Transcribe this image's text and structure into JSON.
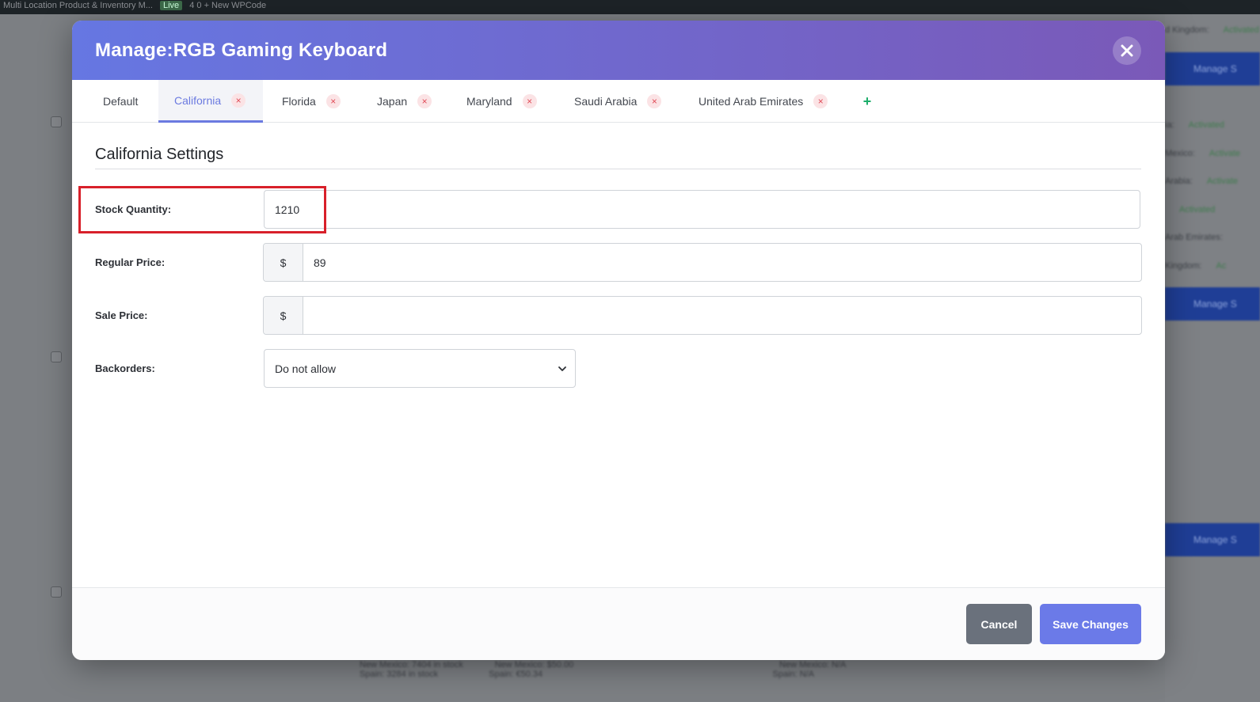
{
  "window": {
    "title": "Manage:RGB Gaming Keyboard"
  },
  "tabs": [
    {
      "label": "Default",
      "removable": false
    },
    {
      "label": "California",
      "removable": true,
      "active": true
    },
    {
      "label": "Florida",
      "removable": true
    },
    {
      "label": "Japan",
      "removable": true
    },
    {
      "label": "Maryland",
      "removable": true
    },
    {
      "label": "Saudi Arabia",
      "removable": true
    },
    {
      "label": "United Arab Emirates",
      "removable": true
    }
  ],
  "tab_remove_glyph": "×",
  "tab_add_glyph": "+",
  "section": {
    "title": "California Settings"
  },
  "fields": {
    "stock_quantity": {
      "label": "Stock Quantity:",
      "value": "1210"
    },
    "regular_price": {
      "label": "Regular Price:",
      "prefix": "$",
      "value": "89"
    },
    "sale_price": {
      "label": "Sale Price:",
      "prefix": "$",
      "value": ""
    },
    "backorders": {
      "label": "Backorders:",
      "selected": "Do not allow"
    }
  },
  "footer": {
    "cancel_label": "Cancel",
    "save_label": "Save Changes"
  },
  "background": {
    "admin_bar_text": "Multi Location Product & Inventory M...",
    "admin_bar_badge": "Live",
    "admin_bar_extra": "4   0   + New   WPCode",
    "right_column": [
      {
        "type": "blue",
        "label": "Manage S"
      },
      {
        "type": "row",
        "label": "d Kingdom:",
        "status": "Activated"
      },
      {
        "type": "row",
        "label": "ia:",
        "status": "Activated"
      },
      {
        "type": "row",
        "label": "Mexico:",
        "status": "Activate"
      },
      {
        "type": "row",
        "label": "Arabia:",
        "status": "Activate"
      },
      {
        "type": "row",
        "label": "",
        "status": "Activated"
      },
      {
        "type": "row",
        "label": "Arab Emirates:",
        "status": ""
      },
      {
        "type": "row",
        "label": "Kingdom:",
        "status": "Ac"
      }
    ],
    "under_text": [
      "New Mexico: 7404 in stock",
      "New Mexico: $50.00",
      "New Mexico: N/A",
      "Spain: 3284 in stock",
      "Spain: €50.34",
      "Spain: N/A"
    ]
  },
  "colors": {
    "header_gradient_start": "#6677e2",
    "header_gradient_end": "#7a59b8",
    "accent": "#6b7ae0",
    "remove_tab": "#e04a56",
    "add_tab": "#1dae6b",
    "highlight_box": "#d8202a",
    "cancel_button": "#6a717c",
    "save_button": "#6b7ae8"
  },
  "icons": {
    "close": "close-icon",
    "tab_remove": "close-icon",
    "tab_add": "plus-icon",
    "select": "chevron-down-icon"
  }
}
